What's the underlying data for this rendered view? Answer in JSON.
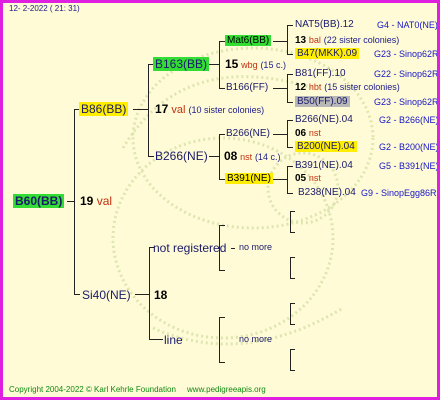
{
  "header": {
    "date": "12-  2-2022 (  21: 31)"
  },
  "footer": {
    "copyright": "Copyright 2004-2022 © Karl Kehrle Foundation",
    "site": "www.pedigreeapis.org"
  },
  "colors": {
    "frame": "#e020e0",
    "background": "#fffbd6",
    "green_hl": "#33dd33",
    "yellow_hl": "#ffee00",
    "grey_hl": "#b8b8b8",
    "red": "#c03010",
    "blue": "#1515c8"
  },
  "root": {
    "name": "B60(BB)",
    "num": "19",
    "tag": "val"
  },
  "gen1": {
    "top": {
      "name": "B86(BB)",
      "num": "17",
      "tag": "val",
      "note": "(10 sister colonies)"
    },
    "bottom": {
      "name": "Si40(NE)",
      "num": "18"
    }
  },
  "gen2": {
    "a": {
      "name": "B163(BB)",
      "num": "15",
      "tag": "wbg",
      "note": "(15 c.)"
    },
    "b": {
      "name": "B266(NE)",
      "num": "08",
      "tag": "nst",
      "note": "(14 c.)"
    },
    "c": {
      "name": "not registered",
      "nomore": "no more"
    },
    "d": {
      "name": "line",
      "nomore": "no more"
    }
  },
  "gen3": {
    "a": {
      "name": "Mat6(BB)"
    },
    "b": {
      "name": "B166(FF)",
      "num": "12",
      "tag": "hbt",
      "note": "(15 sister colonies)"
    },
    "c": {
      "name": "B266(NE)",
      "num": "06",
      "tag": "nst"
    },
    "d": {
      "name": "B391(NE)",
      "num": "05",
      "tag": "nst"
    },
    "a_num": "13",
    "a_tag": "bal",
    "a_note": "(22 sister colonies)"
  },
  "gen4": [
    {
      "name": "NAT5(BB).12",
      "code": "G4 - NAT0(NE)"
    },
    {
      "name": "B47(MKK).09",
      "code": "G23 - Sinop62R"
    },
    {
      "name": "B81(FF).10",
      "code": "G22 - Sinop62R"
    },
    {
      "name": "B50(FF).09",
      "code": "G23 - Sinop62R"
    },
    {
      "name": "B266(NE).04",
      "code": "G2 - B266(NE)"
    },
    {
      "name": "B200(NE).04",
      "code": "G2 - B200(NE)"
    },
    {
      "name": "B391(NE).04",
      "code": "G5 - B391(NE)"
    },
    {
      "name": "B238(NE).04",
      "code": "G9 - SinopEgg86R"
    }
  ]
}
